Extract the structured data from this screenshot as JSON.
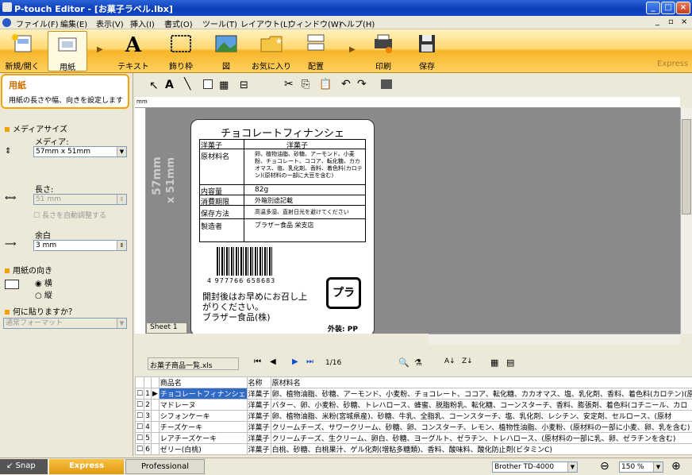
{
  "title": "P-touch Editor - [お菓子ラベル.lbx]",
  "menu": [
    "ファイル(F)",
    "編集(E)",
    "表示(V)",
    "挿入(I)",
    "書式(O)",
    "ツール(T)",
    "レイアウト(L)",
    "ウィンドウ(W)",
    "ヘルプ(H)"
  ],
  "ribbon": {
    "new": "新規/開く",
    "paper": "用紙",
    "text": "テキスト",
    "frame": "飾り枠",
    "image": "図",
    "favorites": "お気に入り",
    "arrange": "配置",
    "print": "印刷",
    "save": "保存",
    "mode": "Express"
  },
  "panel": {
    "title": "用紙",
    "desc": "用紙の長さや幅、向きを設定します",
    "media_size": "メディアサイズ",
    "media_label": "メディア:",
    "media_value": "57mm x 51mm",
    "length_label": "長さ:",
    "length_value": "51 mm",
    "auto_length": "長さを自動調整する",
    "margin_label": "余白",
    "margin_value": "3 mm",
    "orientation": "用紙の向き",
    "portrait": "横",
    "landscape": "縦",
    "use_label": "何に貼りますか？",
    "use_value": "通常フォーマット"
  },
  "canvas": {
    "size_line1": "57mm",
    "size_line2": "x 51mm",
    "sheet_tab": "Sheet 1",
    "ruler_unit": "mm"
  },
  "label": {
    "title": "チョコレートフィナンシェ",
    "r1k": "洋菓子",
    "r1v": "洋菓子",
    "r2k": "原材料名",
    "r2v": "卵、植物油脂、砂糖、アーモンド、小麦粉、チョコレート、ココア、転化糖、カカオマス、塩、乳化剤、香料、着色料(カロテン)(原材料の一部に大豆を含む)",
    "r3k": "内容量",
    "r3v": "82g",
    "r4k": "消費期限",
    "r4v": "外箱別途記載",
    "r5k": "保存方法",
    "r5v": "高温多湿、直射日光を避けてください",
    "r6k": "製造者",
    "r6v": "ブラザー食品 栄支店",
    "barcode": "4  977766  658683",
    "msg1": "開封後はお早めにお召し上",
    "msg2": "がりください。",
    "maker": "ブラザー食品(株)",
    "pack": "外装: PP",
    "recycle": "プラ"
  },
  "db": {
    "file": "お菓子商品一覧.xls",
    "page": "1/16",
    "headers": [
      "",
      "",
      "",
      "商品名",
      "名称",
      "原材料名"
    ],
    "rows": [
      {
        "n": "1",
        "name": "チョコレートフィナンシェ",
        "type": "洋菓子",
        "mat": "卵、植物油脂、砂糖、アーモンド、小麦粉、チョコレート、ココア、転化糖、カカオマス、塩、乳化剤、香料、着色料(カロテン)(原"
      },
      {
        "n": "2",
        "name": "マドレーヌ",
        "type": "洋菓子",
        "mat": "バター、卵、小麦粉、砂糖、トレハロース、蜂蜜、脱脂粉乳、転化糖、コーンスターチ、香料、膨張剤、着色料(コチニール、カロ"
      },
      {
        "n": "3",
        "name": "シフォンケーキ",
        "type": "洋菓子",
        "mat": "卵、植物油脂、米粉(宮城県産)、砂糖、牛乳、全脂乳、コーンスターチ、塩、乳化剤、レシチン、安定剤、セルロース、(原材"
      },
      {
        "n": "4",
        "name": "チーズケーキ",
        "type": "洋菓子",
        "mat": "クリームチーズ、サワークリーム、砂糖、卵、コンスターチ、レモン、植物性油脂、小麦粉、(原材料の一部に小麦、卵、乳を含む)"
      },
      {
        "n": "5",
        "name": "レアチーズケーキ",
        "type": "洋菓子",
        "mat": "クリームチーズ、生クリーム、卵白、砂糖、ヨーグルト、ゼラチン、トレハロース、(原材料の一部に乳、卵、ゼラチンを含む)"
      },
      {
        "n": "6",
        "name": "ゼリー(白桃)",
        "type": "洋菓子",
        "mat": "白桃、砂糖、白桃果汁、ゲル化剤(増粘多糖類)、香料、酸味料、酸化防止剤(ビタミンC)"
      }
    ]
  },
  "status": {
    "snap": "Snap",
    "express": "Express",
    "professional": "Professional",
    "printer": "Brother TD-4000",
    "zoom": "150 %"
  }
}
